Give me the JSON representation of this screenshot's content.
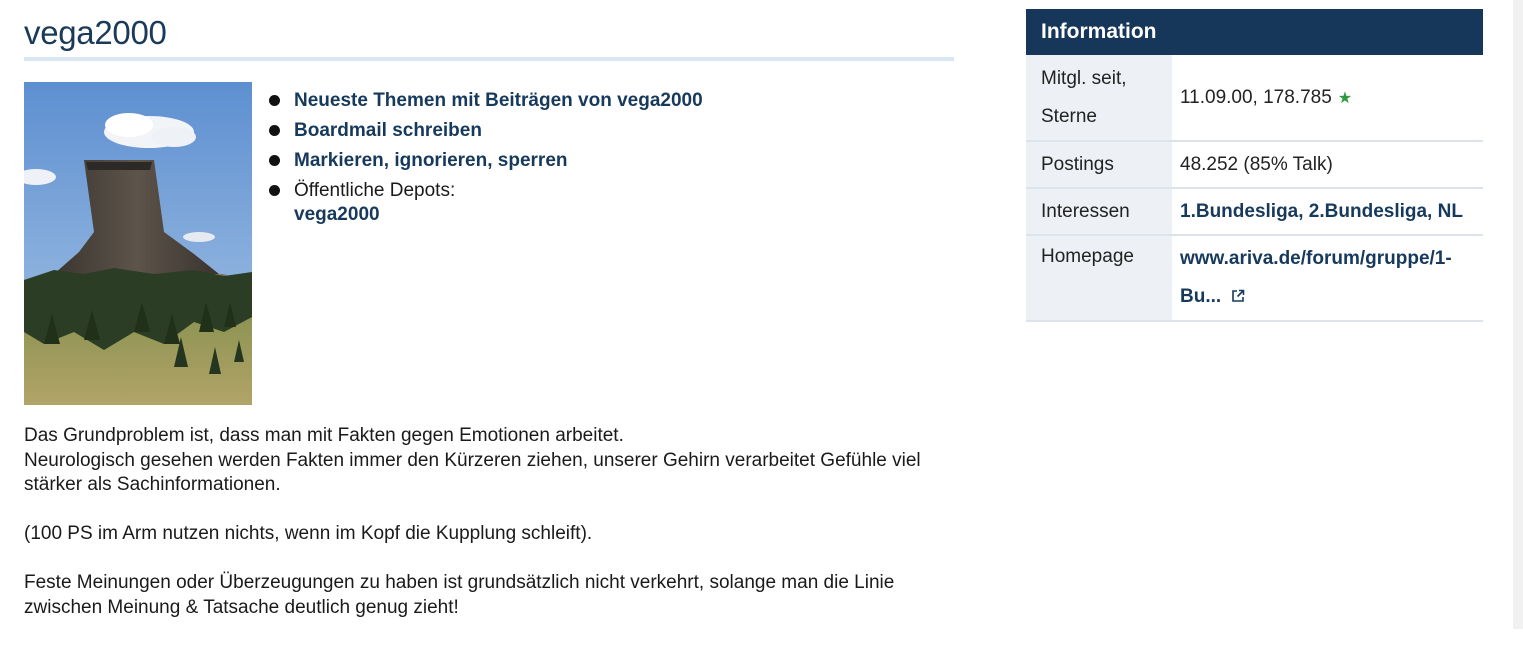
{
  "profile": {
    "username": "vega2000",
    "avatar_icon": "devils-tower-photo"
  },
  "links": {
    "themes": "Neueste Themen mit Beiträgen von vega2000",
    "boardmail": "Boardmail schreiben",
    "mark": "Markieren, ignorieren, sperren",
    "depots_label": "Öffentliche Depots:",
    "depot_link": "vega2000"
  },
  "bio": {
    "line1": "Das Grundproblem ist, dass man mit Fakten gegen Emotionen arbeitet.",
    "line2": "Neurologisch gesehen werden Fakten immer den Kürzeren ziehen, unserer Gehirn verarbeitet Gefühle viel stärker als Sachinformationen.",
    "line3": "(100 PS im Arm nutzen nichts, wenn im Kopf die Kupplung schleift).",
    "line4": "Feste Meinungen oder Überzeugungen zu haben ist grundsätzlich nicht verkehrt, solange man die Linie zwischen Meinung & Tatsache deutlich genug zieht!"
  },
  "info": {
    "header": "Information",
    "rows": {
      "member_since_label_1": "Mitgl. seit,",
      "member_since_label_2": "Sterne",
      "member_since_value": "11.09.00, 178.785",
      "postings_label": "Postings",
      "postings_value": "48.252 (85% Talk)",
      "interests_label": "Interessen",
      "interests_value": "1.Bundesliga, 2.Bundesliga, NL",
      "homepage_label": "Homepage",
      "homepage_value_1": "www.ariva.de/forum/gruppe/1-",
      "homepage_value_2": "Bu..."
    }
  },
  "colors": {
    "brand": "#17375a",
    "link": "#173a5c",
    "star": "#2e9a3e"
  }
}
